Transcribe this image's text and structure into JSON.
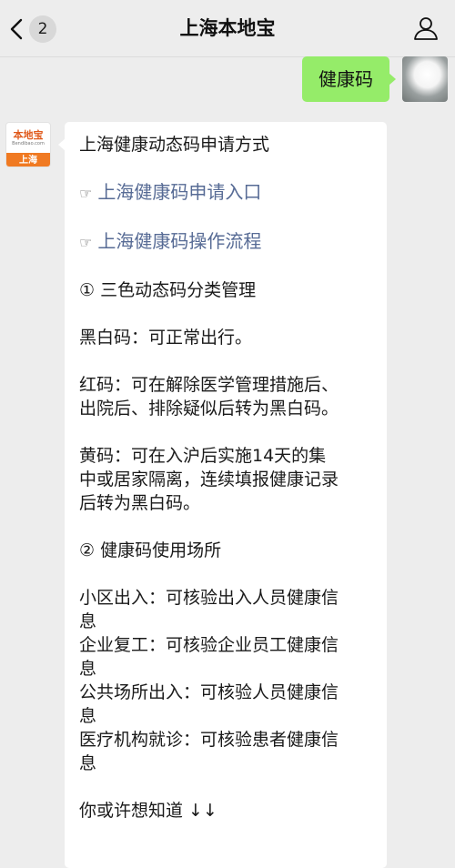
{
  "header": {
    "back_icon": "chevron-left-icon",
    "unread_count": "2",
    "title": "上海本地宝",
    "profile_icon": "person-icon"
  },
  "outgoing": {
    "text": "健康码"
  },
  "incoming": {
    "avatar": {
      "name": "本地宝",
      "url": "Bendibao.com",
      "city": "上海"
    },
    "title": "上海健康动态码申请方式",
    "links": [
      {
        "pointer": "☞",
        "label": "上海健康码申请入口"
      },
      {
        "pointer": "☞",
        "label": "上海健康码操作流程"
      }
    ],
    "section1": "① 三色动态码分类管理",
    "black_white": "黑白码：可正常出行。",
    "red_1": "红码：可在解除医学管理措施后、",
    "red_2": "出院后、排除疑似后转为黑白码。",
    "yellow_1": "黄码：可在入沪后实施14天的集",
    "yellow_2": "中或居家隔离，连续填报健康记录",
    "yellow_3": "后转为黑白码。",
    "section2": "② 健康码使用场所",
    "usage": [
      {
        "l1": "小区出入：可核验出入人员健康信",
        "l2": "息"
      },
      {
        "l1": "企业复工：可核验企业员工健康信",
        "l2": "息"
      },
      {
        "l1": "公共场所出入：可核验人员健康信",
        "l2": "息"
      },
      {
        "l1": "医疗机构就诊：可核验患者健康信",
        "l2": "息"
      }
    ],
    "footer": "你或许想知道 ↓↓"
  }
}
